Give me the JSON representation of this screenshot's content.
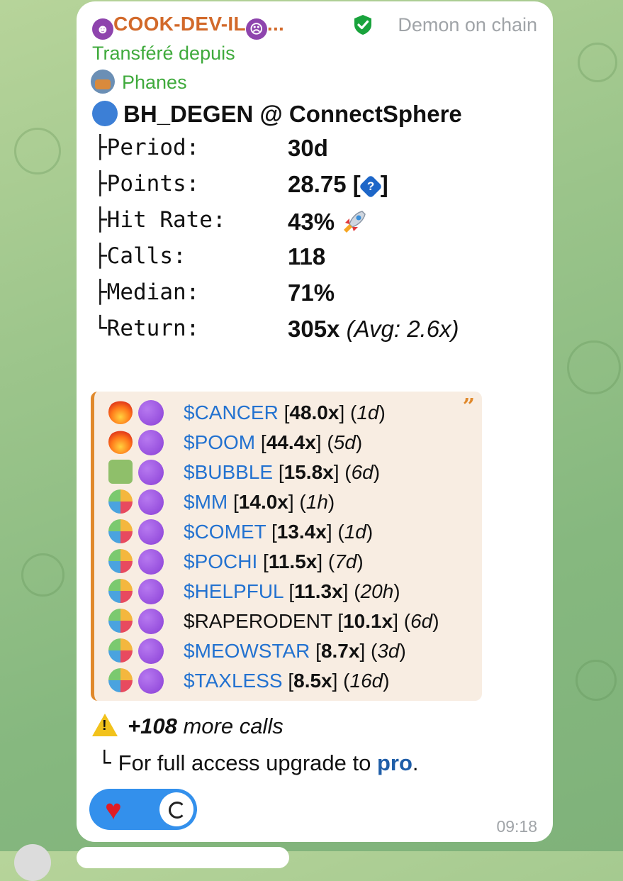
{
  "message": {
    "sender_name": "COOK-DEV-IL",
    "sender_suffix": "...",
    "channel_name": "Demon on chain",
    "forwarded_label": "Transféré depuis",
    "forwarded_from": "Phanes",
    "title": "BH_DEGEN @ ConnectSphere",
    "stats": [
      {
        "key": "├Period:",
        "value": "30d"
      },
      {
        "key": "├Points:",
        "value": "28.75",
        "extra": "[?]"
      },
      {
        "key": "├Hit Rate:",
        "value": "43%"
      },
      {
        "key": "├Calls:",
        "value": "118"
      },
      {
        "key": "├Median:",
        "value": "71%"
      },
      {
        "key": "└Return:",
        "value": "305x",
        "extra": "(Avg: 2.6x)"
      }
    ],
    "calls": [
      {
        "icon": "fire",
        "ticker": "$CANCER",
        "mult": "48.0x",
        "age": "1d"
      },
      {
        "icon": "fire",
        "ticker": "$POOM",
        "mult": "44.4x",
        "age": "5d"
      },
      {
        "icon": "cash",
        "ticker": "$BUBBLE",
        "mult": "15.8x",
        "age": "6d"
      },
      {
        "icon": "party",
        "ticker": "$MM",
        "mult": "14.0x",
        "age": "1h"
      },
      {
        "icon": "party",
        "ticker": "$COMET",
        "mult": "13.4x",
        "age": "1d"
      },
      {
        "icon": "party",
        "ticker": "$POCHI",
        "mult": "11.5x",
        "age": "7d"
      },
      {
        "icon": "party",
        "ticker": "$HELPFUL",
        "mult": "11.3x",
        "age": "20h"
      },
      {
        "icon": "party",
        "ticker": "$RAPERODENT",
        "mult": "10.1x",
        "age": "6d",
        "plain": true
      },
      {
        "icon": "party",
        "ticker": "$MEOWSTAR",
        "mult": "8.7x",
        "age": "3d"
      },
      {
        "icon": "party",
        "ticker": "$TAXLESS",
        "mult": "8.5x",
        "age": "16d"
      }
    ],
    "more_count": "+108",
    "more_text": "more calls",
    "upgrade_tree": "└",
    "upgrade_text": "For full access upgrade to",
    "upgrade_link": "pro",
    "upgrade_period": ".",
    "time": "09:18"
  }
}
